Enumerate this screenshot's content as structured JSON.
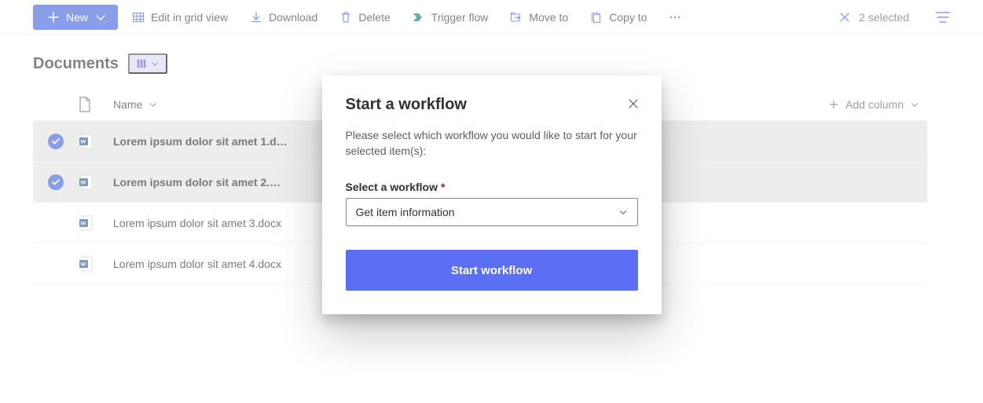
{
  "toolbar": {
    "new_label": "New",
    "edit_grid_label": "Edit in grid view",
    "download_label": "Download",
    "delete_label": "Delete",
    "trigger_flow_label": "Trigger flow",
    "move_to_label": "Move to",
    "copy_to_label": "Copy to",
    "selected_text": "2 selected"
  },
  "page": {
    "title": "Documents"
  },
  "table": {
    "header_name": "Name",
    "add_column": "Add column",
    "rows": [
      {
        "name": "Lorem ipsum dolor sit amet 1.d…",
        "selected": true
      },
      {
        "name": "Lorem ipsum dolor sit amet 2.…",
        "selected": true
      },
      {
        "name": "Lorem ipsum dolor sit amet 3.docx",
        "selected": false
      },
      {
        "name": "Lorem ipsum dolor sit amet 4.docx",
        "selected": false
      }
    ]
  },
  "modal": {
    "title": "Start a workflow",
    "description": "Please select which workflow you would like to start for your selected item(s):",
    "field_label": "Select a workflow",
    "selected_option": "Get item information",
    "submit_label": "Start workflow"
  }
}
